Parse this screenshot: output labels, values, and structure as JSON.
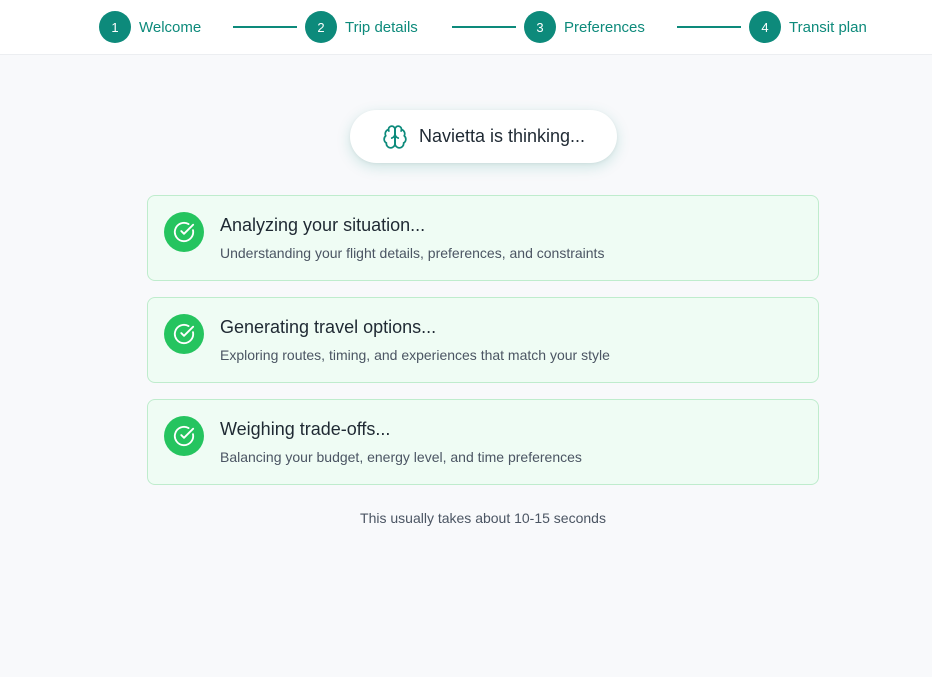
{
  "stepper": {
    "steps": [
      {
        "number": "1",
        "label": "Welcome"
      },
      {
        "number": "2",
        "label": "Trip details"
      },
      {
        "number": "3",
        "label": "Preferences"
      },
      {
        "number": "4",
        "label": "Transit plan"
      }
    ]
  },
  "status": {
    "icon": "brain-icon",
    "label": "Navietta is thinking..."
  },
  "tasks": [
    {
      "icon": "check-circle-icon",
      "title": "Analyzing your situation...",
      "description": "Understanding your flight details, preferences, and constraints"
    },
    {
      "icon": "check-circle-icon",
      "title": "Generating travel options...",
      "description": "Exploring routes, timing, and experiences that match your style"
    },
    {
      "icon": "check-circle-icon",
      "title": "Weighing trade-offs...",
      "description": "Balancing your budget, energy level, and time preferences"
    }
  ],
  "footnote": "This usually takes about 10-15 seconds",
  "colors": {
    "accent": "#0d8a7b",
    "success": "#25c45f",
    "card_bg": "#effcf4",
    "card_border": "#bfeccd"
  }
}
